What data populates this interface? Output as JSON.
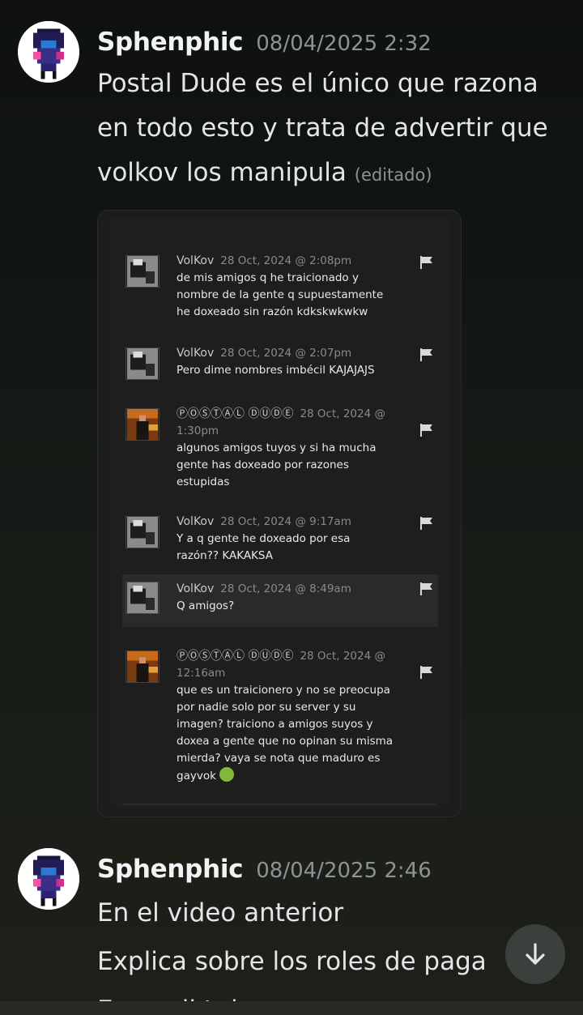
{
  "messages": [
    {
      "username": "Sphenphic",
      "timestamp": "08/04/2025 2:32",
      "lines": [
        "Postal Dude es el único que razona",
        "en todo esto y  trata de advertir que",
        "volkov los manipula"
      ],
      "edited": "(editado)"
    },
    {
      "username": "Sphenphic",
      "timestamp": "08/04/2025 2:46",
      "lines": [
        "En el video anterior",
        "Explica sobre los roles de paga",
        "En pocil t de"
      ]
    }
  ],
  "embed": {
    "comments": [
      {
        "author": "VolKov",
        "date": "28 Oct, 2024 @ 2:08pm",
        "body": [
          "de mis amigos q he traicionado y",
          "nombre de la gente q supuestamente",
          "he doxeado sin razón kdkskwkwkw"
        ],
        "icon": "flag-icon"
      },
      {
        "author": "VolKov",
        "date": "28 Oct, 2024 @ 2:07pm",
        "body": [
          "Pero dime nombres imbécil KAJAJAJS"
        ],
        "icon": "flag-icon"
      },
      {
        "author": "ⓅⓄⓈⓉⒶⓁ ⒹⓊⒹⒺ",
        "date": "28 Oct, 2024 @",
        "date2": "1:30pm",
        "body": [
          "algunos amigos tuyos y si ha mucha",
          "gente has doxeado por razones",
          "estupidas"
        ],
        "icon": "flag-icon"
      },
      {
        "author": "VolKov",
        "date": "28 Oct, 2024 @ 9:17am",
        "body": [
          "Y a q gente he doxeado por esa",
          "razón?? KAKAKSA"
        ],
        "icon": "flag-icon"
      },
      {
        "author": "VolKov",
        "date": "28 Oct, 2024 @ 8:49am",
        "body": [
          "Q amigos?"
        ],
        "icon": "flag-icon"
      },
      {
        "author": "ⓅⓄⓈⓉⒶⓁ ⒹⓊⒹⒺ",
        "date": "28 Oct, 2024 @",
        "date2": "12:16am",
        "body": [
          "que es un traicionero y no se preocupa",
          "por nadie solo por su server y su",
          "imagen? traiciono a amigos suyos y",
          "doxea a gente que no opinan su misma",
          "mierda? vaya se nota que maduro es",
          "gayvok"
        ],
        "icon": "flag-icon"
      }
    ]
  },
  "ui": {
    "scroll_icon": "arrow-down-icon"
  },
  "colors": {
    "background": "#141915",
    "accent_avatar": "#ffffff",
    "embed_bg": "#1e1e1e"
  }
}
